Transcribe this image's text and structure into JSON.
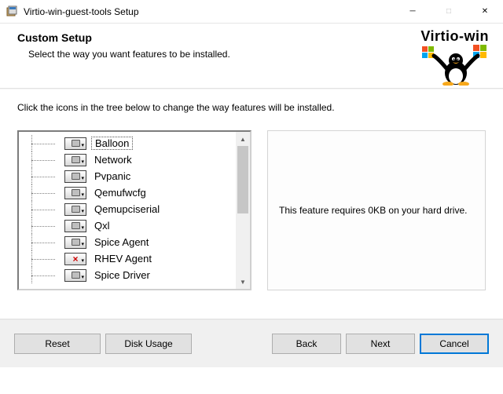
{
  "window": {
    "title": "Virtio-win-guest-tools Setup"
  },
  "brand": {
    "text": "Virtio-win"
  },
  "header": {
    "heading": "Custom Setup",
    "subheading": "Select the way you want features to be installed."
  },
  "instructions": "Click the icons in the tree below to change the way features will be installed.",
  "features": [
    {
      "label": "Balloon",
      "state": "install",
      "selected": true
    },
    {
      "label": "Network",
      "state": "install",
      "selected": false
    },
    {
      "label": "Pvpanic",
      "state": "install",
      "selected": false
    },
    {
      "label": "Qemufwcfg",
      "state": "install",
      "selected": false
    },
    {
      "label": "Qemupciserial",
      "state": "install",
      "selected": false
    },
    {
      "label": "Qxl",
      "state": "install",
      "selected": false
    },
    {
      "label": "Spice Agent",
      "state": "install",
      "selected": false
    },
    {
      "label": "RHEV Agent",
      "state": "exclude",
      "selected": false
    },
    {
      "label": "Spice Driver",
      "state": "install",
      "selected": false
    }
  ],
  "description": "This feature requires 0KB on your hard drive.",
  "buttons": {
    "reset": "Reset",
    "disk_usage": "Disk Usage",
    "back": "Back",
    "next": "Next",
    "cancel": "Cancel"
  }
}
